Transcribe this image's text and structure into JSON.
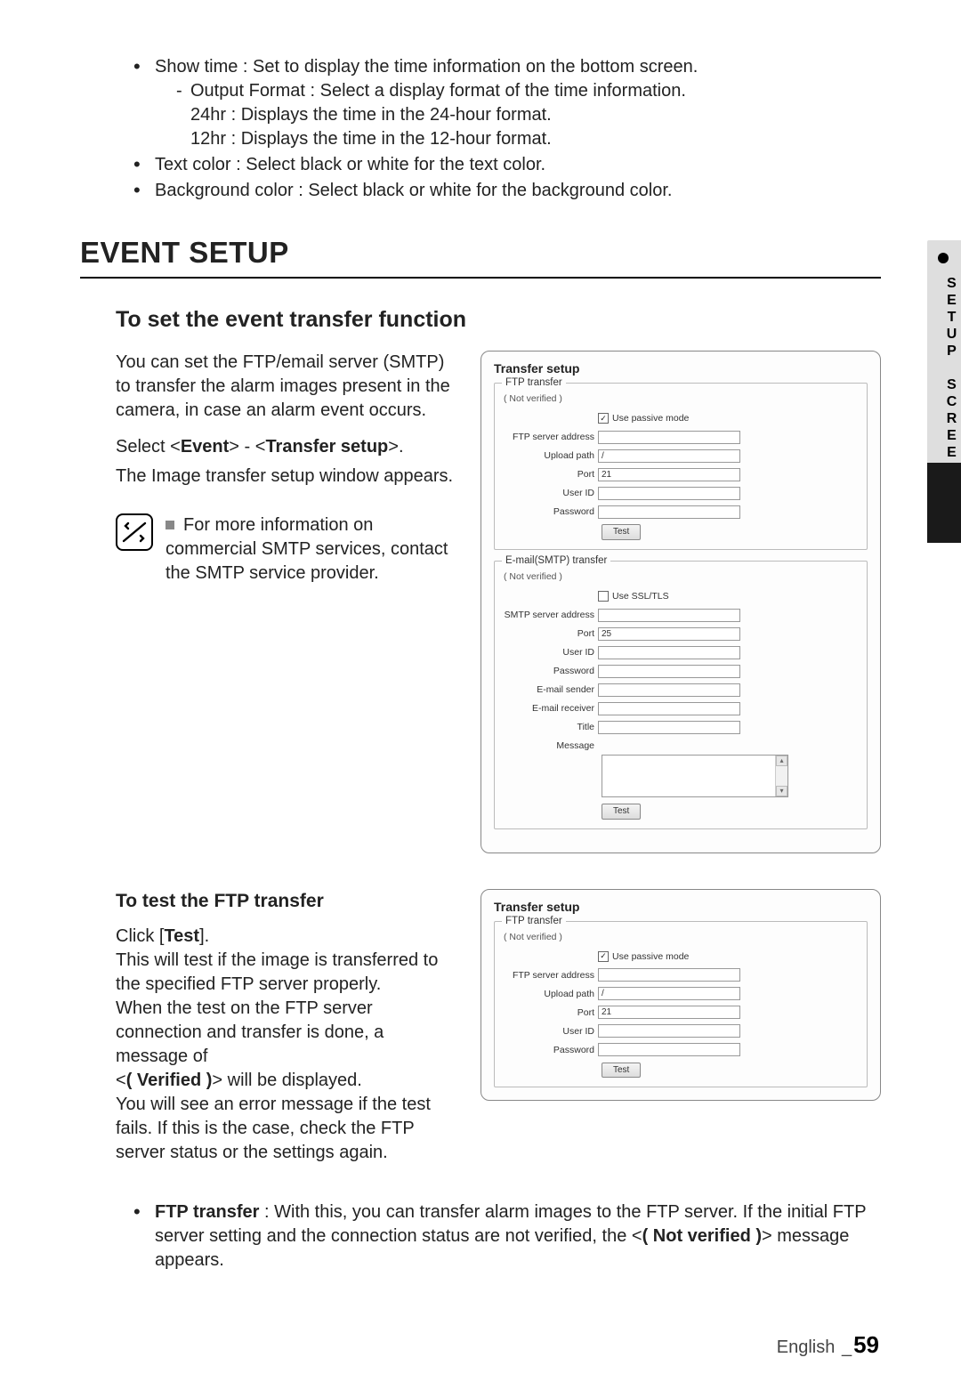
{
  "top": {
    "b1": "Show time : Set to display the time information on the bottom screen.",
    "b1_sub_dash": "Output Format : Select a display format of the time information.",
    "b1_sub_l1": "24hr : Displays the time in the 24-hour format.",
    "b1_sub_l2": "12hr : Displays the time in the 12-hour format.",
    "b2": "Text color : Select black or white for the text color.",
    "b3": "Background color : Select black or white for the background color."
  },
  "section_title": "EVENT SETUP",
  "set_fn": {
    "heading": "To set the event transfer function",
    "para1": "You can set the FTP/email server (SMTP) to transfer the alarm images present in the camera, in case an alarm event occurs.",
    "nav_pre": "Select <",
    "nav_b1": "Event",
    "nav_mid": "> - <",
    "nav_b2": "Transfer setup",
    "nav_post": ">.",
    "para2": "The Image transfer setup window appears.",
    "note": "For more information on commercial SMTP services, contact the SMTP service provider."
  },
  "panel": {
    "title": "Transfer setup",
    "not_verified": "( Not verified )",
    "ftp": {
      "legend": "FTP transfer",
      "use_passive": "Use passive mode",
      "server_lbl": "FTP server address",
      "upload_lbl": "Upload path",
      "upload_val": "/",
      "port_lbl": "Port",
      "port_val": "21",
      "user_lbl": "User ID",
      "pwd_lbl": "Password",
      "test": "Test"
    },
    "smtp": {
      "legend": "E-mail(SMTP) transfer",
      "use_ssl": "Use SSL/TLS",
      "server_lbl": "SMTP server address",
      "port_lbl": "Port",
      "port_val": "25",
      "user_lbl": "User ID",
      "pwd_lbl": "Password",
      "sender_lbl": "E-mail sender",
      "receiver_lbl": "E-mail receiver",
      "title_lbl": "Title",
      "msg_lbl": "Message",
      "test": "Test"
    }
  },
  "test_ftp": {
    "heading": "To test the FTP transfer",
    "pre": "Click [",
    "bold": "Test",
    "post": "].",
    "l1": "This will test if the image is transferred to the specified FTP server properly.",
    "l2": "When the test on the FTP server connection and transfer is done, a message of",
    "l3_pre": "<",
    "l3_bold": "( Verified )",
    "l3_post": "> will be displayed.",
    "l4": "You will see an error message if the test fails. If this is the case, check the FTP server status or the settings again."
  },
  "bottom_bullet": {
    "bold": "FTP transfer",
    "text1": " : With this, you can transfer alarm images to the FTP server. If the initial FTP server setting and the connection status are not verified, the <",
    "bold2": "( Not verified )",
    "text2": "> message appears."
  },
  "side_tab": "SETUP SCREEN",
  "footer": {
    "lang": "English",
    "sep": "_",
    "page": "59"
  }
}
